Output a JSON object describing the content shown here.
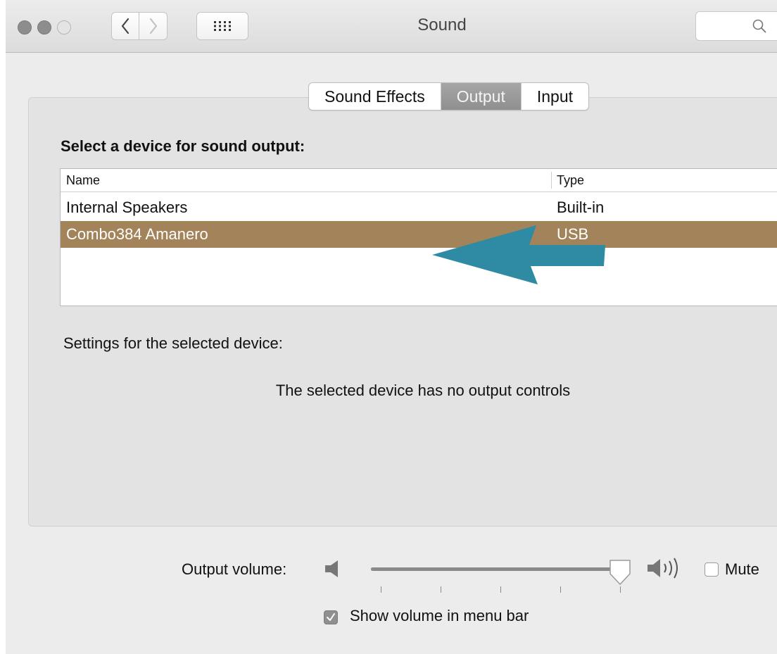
{
  "window": {
    "title": "Sound",
    "traffic_lights": [
      "close",
      "minimize",
      "zoom"
    ],
    "nav": {
      "back_icon": "chevron-left-icon",
      "forward_icon": "chevron-right-icon",
      "grid_icon": "grid-icon"
    },
    "search": {
      "placeholder": "",
      "icon": "search-icon"
    }
  },
  "tabs": [
    {
      "label": "Sound Effects",
      "active": false
    },
    {
      "label": "Output",
      "active": true
    },
    {
      "label": "Input",
      "active": false
    }
  ],
  "device_section": {
    "title": "Select a device for sound output:",
    "columns": [
      "Name",
      "Type"
    ],
    "rows": [
      {
        "name": "Internal Speakers",
        "type": "Built-in",
        "selected": false
      },
      {
        "name": "Combo384 Amanero",
        "type": "USB",
        "selected": true
      }
    ],
    "selection_color": "#a3835a"
  },
  "settings": {
    "label": "Settings for the selected device:",
    "message": "The selected device has no output controls"
  },
  "annotation": {
    "icon": "arrow-left-icon",
    "color": "#2f8aa3"
  },
  "volume": {
    "label": "Output volume:",
    "level_percent": 96,
    "low_icon": "speaker-low-icon",
    "high_icon": "speaker-high-icon",
    "mute_label": "Mute",
    "mute_checked": false,
    "show_in_menubar_label": "Show volume in menu bar",
    "show_in_menubar_checked": true
  }
}
